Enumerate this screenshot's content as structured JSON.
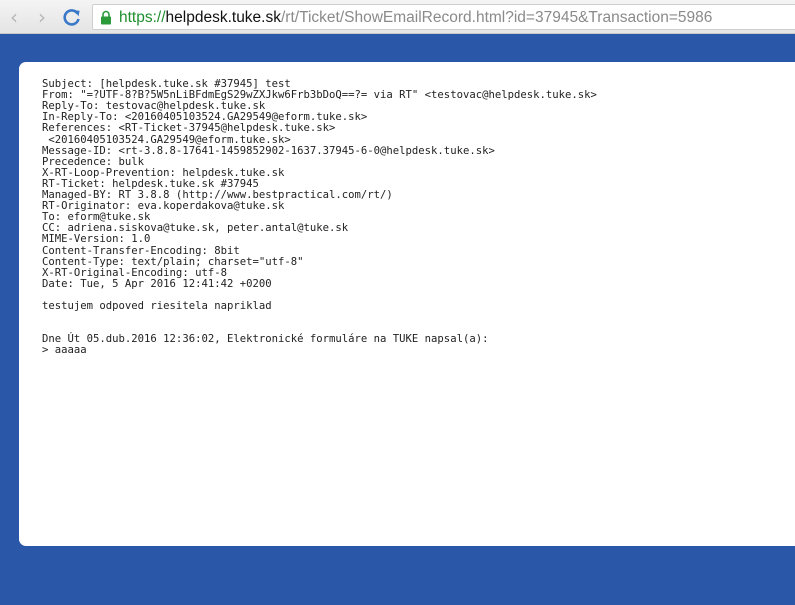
{
  "browser": {
    "url_scheme": "https://",
    "url_host": "helpdesk.tuke.sk",
    "url_path": "/rt/Ticket/ShowEmailRecord.html?id=37945&Transaction=5986"
  },
  "email": {
    "headers": [
      "Subject: [helpdesk.tuke.sk #37945] test",
      "From: \"=?UTF-8?B?5W5nLiBFdmEgS29wZXJkw6Frb3bDoQ==?= via RT\" <testovac@helpdesk.tuke.sk>",
      "Reply-To: testovac@helpdesk.tuke.sk",
      "In-Reply-To: <20160405103524.GA29549@eform.tuke.sk>",
      "References: <RT-Ticket-37945@helpdesk.tuke.sk>",
      " <20160405103524.GA29549@eform.tuke.sk>",
      "Message-ID: <rt-3.8.8-17641-1459852902-1637.37945-6-0@helpdesk.tuke.sk>",
      "Precedence: bulk",
      "X-RT-Loop-Prevention: helpdesk.tuke.sk",
      "RT-Ticket: helpdesk.tuke.sk #37945",
      "Managed-BY: RT 3.8.8 (http://www.bestpractical.com/rt/)",
      "RT-Originator: eva.koperdakova@tuke.sk",
      "To: eform@tuke.sk",
      "CC: adriena.siskova@tuke.sk, peter.antal@tuke.sk",
      "MIME-Version: 1.0",
      "Content-Transfer-Encoding: 8bit",
      "Content-Type: text/plain; charset=\"utf-8\"",
      "X-RT-Original-Encoding: utf-8",
      "Date: Tue, 5 Apr 2016 12:41:42 +0200"
    ],
    "body_text": "testujem odpoved riesitela napriklad",
    "quote_intro": "Dne Út 05.dub.2016 12:36:02, Elektronické formuláre na TUKE napsal(a):",
    "quote_text": "> aaaaa"
  }
}
